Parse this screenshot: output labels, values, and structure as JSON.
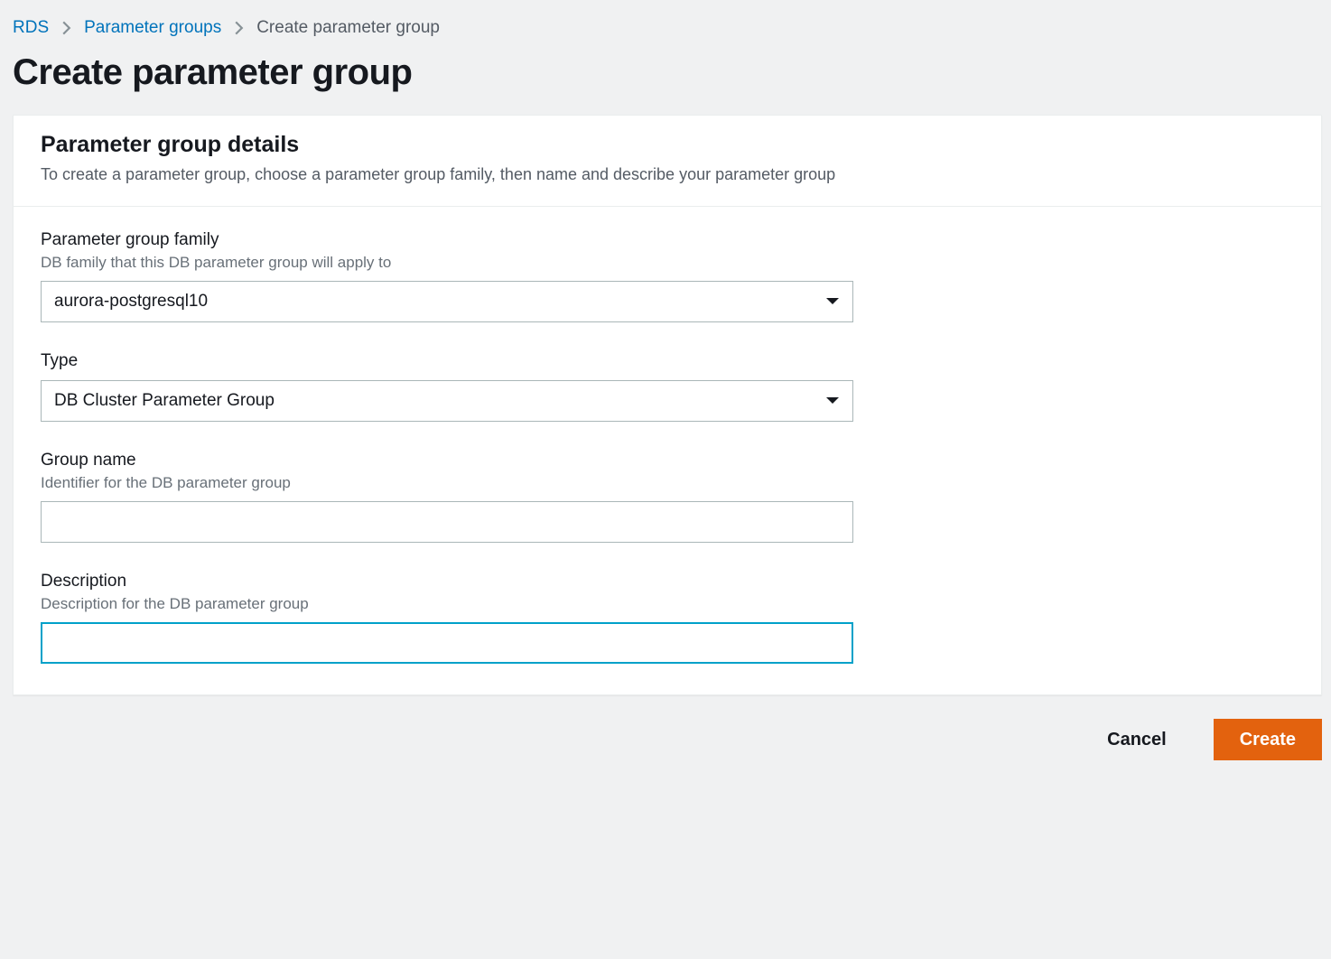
{
  "breadcrumb": {
    "items": [
      {
        "label": "RDS",
        "link": true
      },
      {
        "label": "Parameter groups",
        "link": true
      },
      {
        "label": "Create parameter group",
        "link": false
      }
    ]
  },
  "page": {
    "title": "Create parameter group"
  },
  "panel": {
    "header": {
      "title": "Parameter group details",
      "subtitle": "To create a parameter group, choose a parameter group family, then name and describe your parameter group"
    },
    "fields": {
      "family": {
        "label": "Parameter group family",
        "hint": "DB family that this DB parameter group will apply to",
        "value": "aurora-postgresql10"
      },
      "type": {
        "label": "Type",
        "value": "DB Cluster Parameter Group"
      },
      "group_name": {
        "label": "Group name",
        "hint": "Identifier for the DB parameter group",
        "value": ""
      },
      "description": {
        "label": "Description",
        "hint": "Description for the DB parameter group",
        "value": ""
      }
    }
  },
  "footer": {
    "cancel": "Cancel",
    "create": "Create"
  }
}
